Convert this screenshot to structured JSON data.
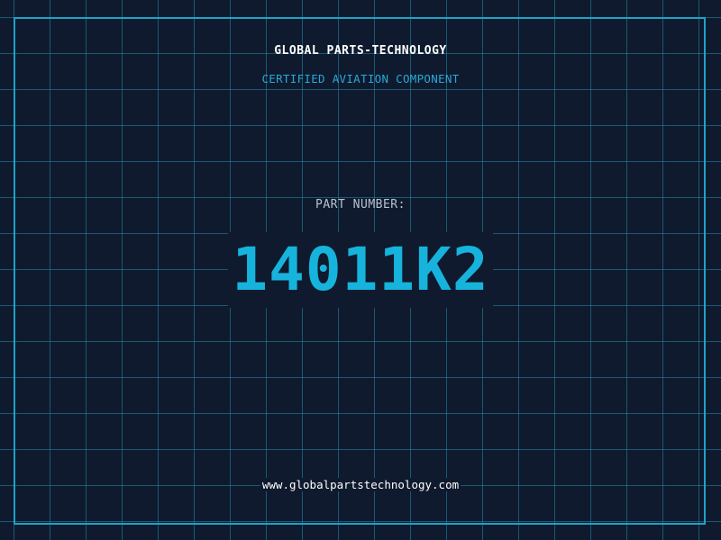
{
  "header": {
    "company": "GLOBAL PARTS-TECHNOLOGY",
    "tagline": "CERTIFIED AVIATION COMPONENT"
  },
  "part": {
    "label": "PART NUMBER:",
    "number": "14011K2"
  },
  "footer": {
    "website": "www.globalpartstechnology.com"
  },
  "colors": {
    "background": "#0f1a2e",
    "grid": "#228caa",
    "accent": "#16b4dc",
    "frame": "#1fa2c9"
  }
}
